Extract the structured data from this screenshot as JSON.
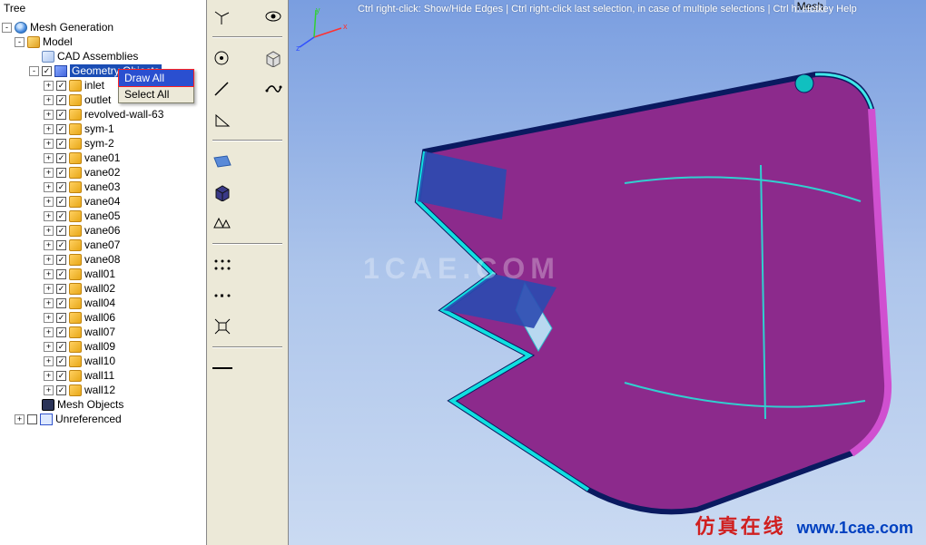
{
  "tree": {
    "title": "Tree",
    "root": "Mesh Generation",
    "model": "Model",
    "cad": "CAD Assemblies",
    "geometry": "Geometry Objects",
    "parts": [
      "inlet",
      "outlet",
      "revolved-wall-63",
      "sym-1",
      "sym-2",
      "vane01",
      "vane02",
      "vane03",
      "vane04",
      "vane05",
      "vane06",
      "vane07",
      "vane08",
      "wall01",
      "wall02",
      "wall04",
      "wall06",
      "wall07",
      "wall09",
      "wall10",
      "wall11",
      "wall12"
    ],
    "mesh_objects": "Mesh Objects",
    "unreferenced": "Unreferenced"
  },
  "context_menu": {
    "draw_all": "Draw All",
    "select_all": "Select All"
  },
  "viewport": {
    "hint": "Ctrl right-click: Show/Hide Edges | Ctrl right-click last selection, in case of multiple selections | Ctrl h: Hotkey Help",
    "mode_label": "Mesh"
  },
  "watermark": {
    "center": "1CAE.COM",
    "cn": "仿真在线",
    "url": "www.1cae.com"
  },
  "icons": {
    "axes": "axes-icon",
    "eye": "eye-icon",
    "point": "point-icon",
    "box": "box-icon",
    "line": "line-icon",
    "spline": "spline-icon",
    "triangle": "triangle-icon",
    "plane": "plane-icon",
    "cube": "cube-icon",
    "sizing": "sizing-icon",
    "grid": "grid-icon",
    "node": "node-icon",
    "expand": "expand-icon",
    "slash": "slash-icon"
  }
}
